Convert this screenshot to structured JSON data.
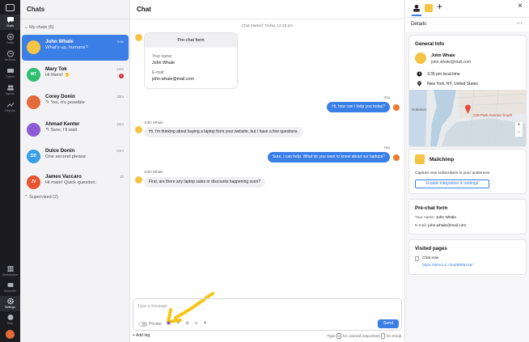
{
  "rail": [
    {
      "label": "Chats",
      "icon": "chat-icon"
    },
    {
      "label": "Traffic",
      "icon": "traffic-icon"
    },
    {
      "label": "Archives",
      "icon": "archive-icon"
    },
    {
      "label": "Tickets",
      "icon": "ticket-icon"
    },
    {
      "label": "Agents",
      "icon": "agents-icon"
    },
    {
      "label": "Reports",
      "icon": "reports-icon"
    },
    {
      "label": "Marketplace",
      "icon": "grid-icon"
    },
    {
      "label": "Subscribe",
      "icon": "subscribe-icon"
    },
    {
      "label": "Settings",
      "icon": "gear-icon"
    },
    {
      "label": "Help",
      "icon": "help-icon"
    }
  ],
  "chats": {
    "title": "Chats",
    "group_label": "My chats (6)",
    "supervised_label": "Supervised (2)",
    "items": [
      {
        "name": "John Whale",
        "preview": "What's up, humans?",
        "time": "now",
        "initials": "",
        "color": "#f6c445"
      },
      {
        "name": "Mary Tok",
        "preview": "Hi there! ✋",
        "time": "22m",
        "initials": "MT",
        "color": "#2fbf71",
        "badge": "1"
      },
      {
        "name": "Corey Donin",
        "preview": "↰ Yes, it's possible",
        "time": "30m",
        "initials": "",
        "color": "#e36b3a"
      },
      {
        "name": "Ahmad Kenter",
        "preview": "↰ Sure, I'll wait",
        "time": "40m",
        "initials": "",
        "color": "#8d5bd6"
      },
      {
        "name": "Dulce Donin",
        "preview": "One second please",
        "time": "53m",
        "initials": "DD",
        "color": "#3a9ee6"
      },
      {
        "name": "James Vaccaro",
        "preview": "Hi mate! Quick question:",
        "time": "1h",
        "initials": "JV",
        "color": "#e9532f"
      }
    ]
  },
  "chat": {
    "title": "Chat",
    "started": "Chat started: Today, 12:28 pm",
    "form": {
      "header": "Pre-chat form",
      "name_label": "Your name:",
      "name_value": "John Whale",
      "email_label": "E-mail:",
      "email_value": "john.whale@mail.com"
    },
    "msg1_sender": "You",
    "msg1": "Hi, how can I help you today?",
    "msg2_sender": "John Whale",
    "msg2": "Hi, I'm thinking about buying a laptop from your website, but I have a few questions.",
    "msg3_sender": "You",
    "msg3": "Sure, I can help. What do you want to know about our laptops?",
    "msg4_sender": "John Whale",
    "msg4": "First, are there any laptop sales or discounts happening soon?",
    "composer_placeholder": "Type a message...",
    "private_label": "Private",
    "send_label": "Send",
    "add_tag": "+ Add tag",
    "hint_prefix": "Type",
    "hint_key1": "#",
    "hint_mid": "for canned responses",
    "hint_key2": ":",
    "hint_suffix": "for emoji"
  },
  "details": {
    "title": "Details",
    "general_info": "General Info",
    "name": "John Whale",
    "email": "john.whale@mail.com",
    "local_time": "3:35 pm local time",
    "location": "New York, NY, United States",
    "map": {
      "hoboken": "Hoboken",
      "address": "228 Park Avenue South",
      "zoom_in": "+",
      "zoom_out": "−"
    },
    "mailchimp_title": "Mailchimp",
    "mailchimp_desc": "Capture new subscribers to your audiences",
    "mailchimp_button": "Enable integration in settings",
    "prechat_title": "Pre-chat form",
    "prechat_name_label": "Your name:",
    "prechat_name": "John Whale",
    "prechat_email_label": "E-mail:",
    "prechat_email": "john.whale@mail.com",
    "visited_title": "Visited pages",
    "visited_page": "Chat now",
    "visited_url": "https://direct.lc.chat/8656216/"
  },
  "colors": {
    "accent": "#3a7ee6",
    "rail": "#1b1b20",
    "annotation_arrow": "#f5c518"
  }
}
